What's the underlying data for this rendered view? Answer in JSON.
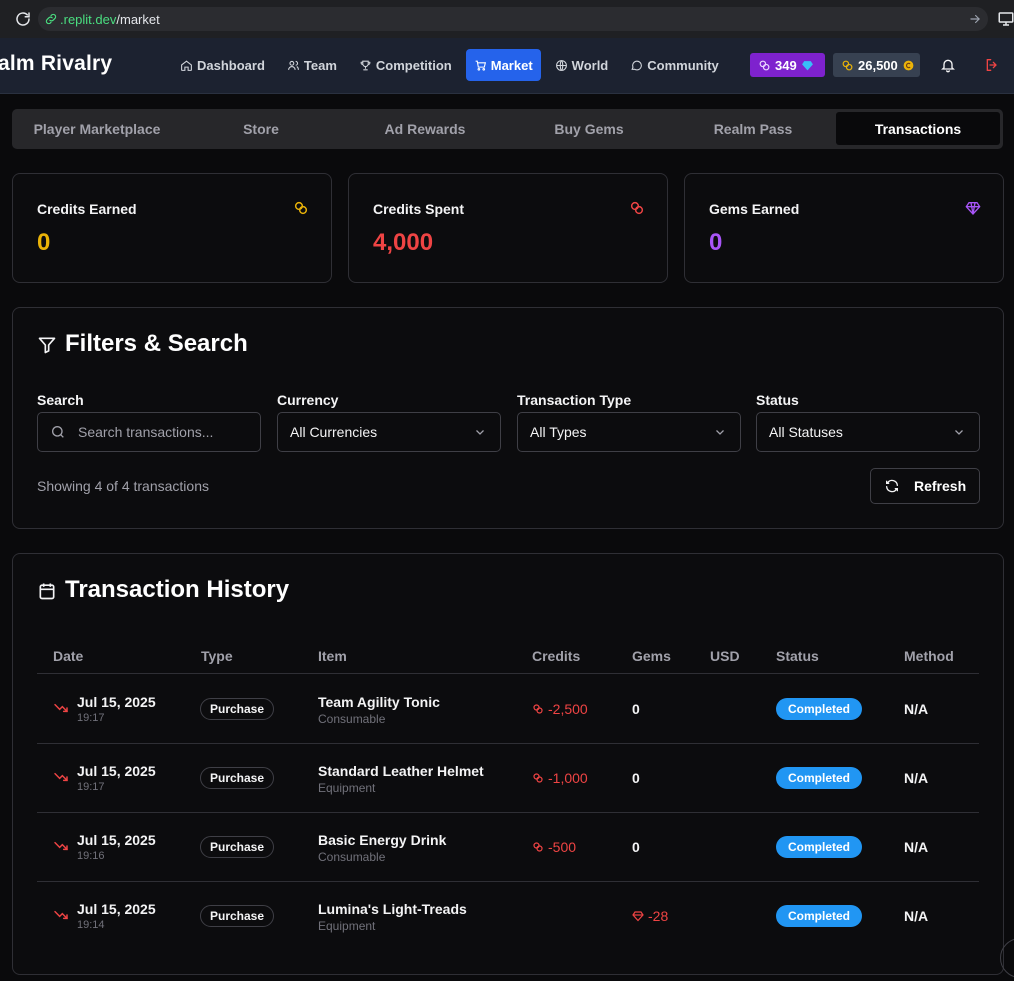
{
  "browser": {
    "url_host": ".replit.dev",
    "url_path": "/market"
  },
  "header": {
    "brand": "alm Rivalry",
    "nav": [
      {
        "label": "Dashboard",
        "icon": "home-icon"
      },
      {
        "label": "Team",
        "icon": "users-icon"
      },
      {
        "label": "Competition",
        "icon": "trophy-icon"
      },
      {
        "label": "Market",
        "icon": "cart-icon",
        "active": true
      },
      {
        "label": "World",
        "icon": "globe-icon"
      },
      {
        "label": "Community",
        "icon": "chat-icon"
      }
    ],
    "gems_balance": "349",
    "credits_balance": "26,500"
  },
  "tabs": [
    "Player Marketplace",
    "Store",
    "Ad Rewards",
    "Buy Gems",
    "Realm Pass",
    "Transactions"
  ],
  "active_tab": "Transactions",
  "stats": {
    "credits_earned": {
      "label": "Credits Earned",
      "value": "0",
      "color": "#eab308"
    },
    "credits_spent": {
      "label": "Credits Spent",
      "value": "4,000",
      "color": "#ef4444"
    },
    "gems_earned": {
      "label": "Gems Earned",
      "value": "0",
      "color": "#a855f7"
    }
  },
  "filters": {
    "title": "Filters & Search",
    "search_label": "Search",
    "search_placeholder": "Search transactions...",
    "currency_label": "Currency",
    "currency_value": "All Currencies",
    "type_label": "Transaction Type",
    "type_value": "All Types",
    "status_label": "Status",
    "status_value": "All Statuses",
    "showing": "Showing 4 of 4 transactions",
    "refresh_label": "Refresh"
  },
  "history": {
    "title": "Transaction History",
    "columns": [
      "Date",
      "Type",
      "Item",
      "Credits",
      "Gems",
      "USD",
      "Status",
      "Method"
    ],
    "rows": [
      {
        "date": "Jul 15, 2025",
        "time": "19:17",
        "type": "Purchase",
        "item": "Team Agility Tonic",
        "category": "Consumable",
        "credits": "-2,500",
        "gems": "0",
        "usd": "",
        "status": "Completed",
        "method": "N/A"
      },
      {
        "date": "Jul 15, 2025",
        "time": "19:17",
        "type": "Purchase",
        "item": "Standard Leather Helmet",
        "category": "Equipment",
        "credits": "-1,000",
        "gems": "0",
        "usd": "",
        "status": "Completed",
        "method": "N/A"
      },
      {
        "date": "Jul 15, 2025",
        "time": "19:16",
        "type": "Purchase",
        "item": "Basic Energy Drink",
        "category": "Consumable",
        "credits": "-500",
        "gems": "0",
        "usd": "",
        "status": "Completed",
        "method": "N/A"
      },
      {
        "date": "Jul 15, 2025",
        "time": "19:14",
        "type": "Purchase",
        "item": "Lumina's Light-Treads",
        "category": "Equipment",
        "credits": "",
        "gems": "-28",
        "usd": "",
        "status": "Completed",
        "method": "N/A"
      }
    ]
  }
}
